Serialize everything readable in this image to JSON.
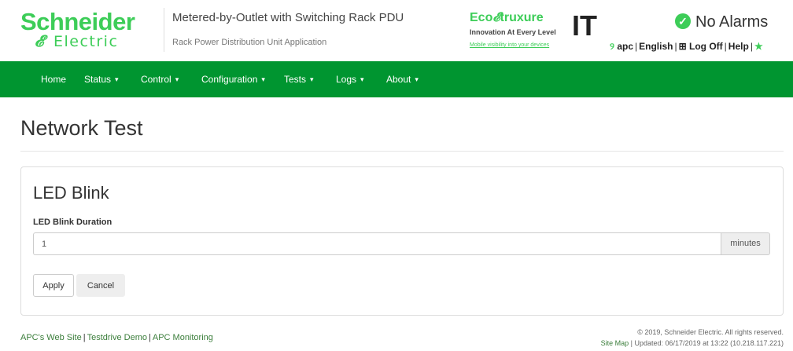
{
  "header": {
    "logo_line1": "Schneider",
    "logo_line2": "Electric",
    "product_title": "Metered-by-Outlet with Switching Rack PDU",
    "product_subtitle": "Rack Power Distribution Unit Application",
    "eco_brand": "Eco",
    "eco_brand2": "truxure",
    "eco_tagline": "Innovation At Every Level",
    "eco_link": "Mobile visibility into your devices",
    "eco_it": "IT",
    "alarm_status": "No Alarms",
    "user": "apc",
    "language": "English",
    "logoff": "Log Off",
    "help": "Help"
  },
  "nav": {
    "items": [
      {
        "label": "Home",
        "dropdown": false
      },
      {
        "label": "Status",
        "dropdown": true
      },
      {
        "label": "Control",
        "dropdown": true
      },
      {
        "label": "Configuration",
        "dropdown": true
      },
      {
        "label": "Tests",
        "dropdown": true
      },
      {
        "label": "Logs",
        "dropdown": true
      },
      {
        "label": "About",
        "dropdown": true
      }
    ]
  },
  "page": {
    "title": "Network Test",
    "panel_title": "LED Blink",
    "field_label": "LED Blink Duration",
    "field_value": "1",
    "field_unit": "minutes",
    "apply_label": "Apply",
    "cancel_label": "Cancel"
  },
  "footer": {
    "link1": "APC's Web Site",
    "link2": "Testdrive Demo",
    "link3": "APC Monitoring",
    "copyright": "© 2019, Schneider Electric. All rights reserved.",
    "sitemap": "Site Map",
    "updated": "Updated: 06/17/2019 at 13:22 (10.218.117.221)"
  },
  "colors": {
    "brand_green": "#3dcd58",
    "nav_green": "#009530"
  }
}
